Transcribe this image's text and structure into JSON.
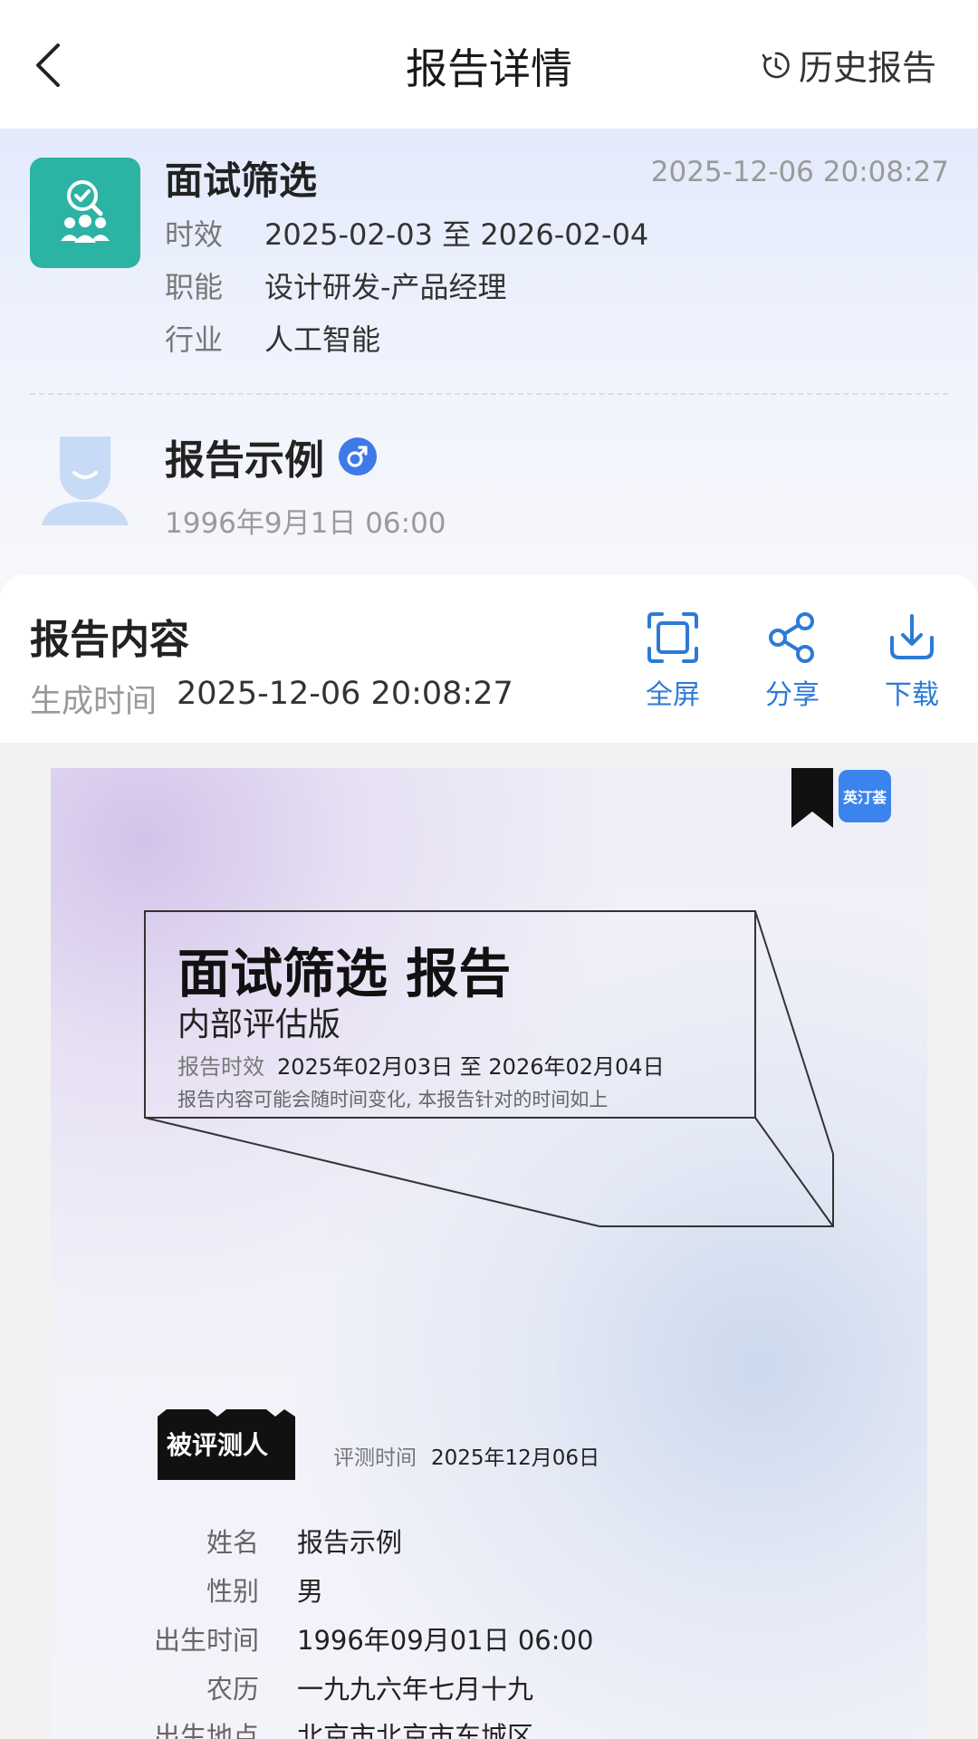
{
  "header": {
    "title": "报告详情",
    "history_label": "历史报告"
  },
  "job": {
    "title": "面试筛选",
    "created": "2025-12-06 20:08:27",
    "fields": [
      {
        "label": "时效",
        "value": "2025-02-03 至 2026-02-04"
      },
      {
        "label": "职能",
        "value": "设计研发-产品经理"
      },
      {
        "label": "行业",
        "value": "人工智能"
      }
    ]
  },
  "person": {
    "name": "报告示例",
    "gender_symbol": "♂",
    "birth": "1996年9月1日 06:00"
  },
  "report": {
    "title": "报告内容",
    "generated_label": "生成时间",
    "generated_value": "2025-12-06 20:08:27",
    "actions": {
      "fullscreen": "全屏",
      "share": "分享",
      "download": "下载"
    }
  },
  "document": {
    "brand": "英汀荟",
    "title": "面试筛选 报告",
    "subtitle": "内部评估版",
    "validity_label": "报告时效",
    "validity_value": "2025年02月03日 至 2026年02月04日",
    "note": "报告内容可能会随时间变化, 本报告针对的时间如上",
    "subject_tag": "被评测人",
    "eval_label": "评测时间",
    "eval_value": "2025年12月06日",
    "fields": [
      {
        "label": "姓名",
        "value": "报告示例"
      },
      {
        "label": "性别",
        "value": "男"
      },
      {
        "label": "出生时间",
        "value": "1996年09月01日 06:00"
      },
      {
        "label": "农历",
        "value": "一九九六年七月十九"
      },
      {
        "label": "出生地点",
        "value": "北京市北京市东城区"
      }
    ]
  },
  "colors": {
    "accent_blue": "#2d7ad6",
    "teal_icon": "#2bb3a3",
    "gender_blue": "#3f79e8"
  }
}
